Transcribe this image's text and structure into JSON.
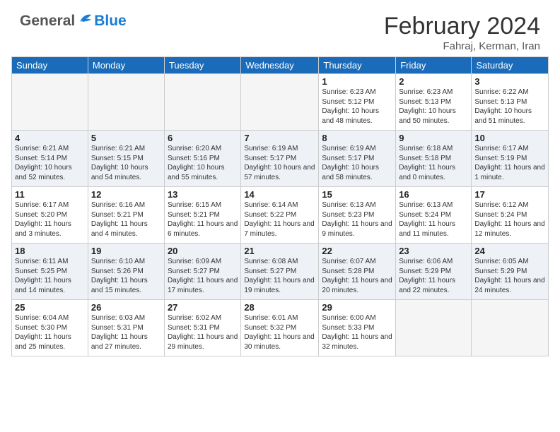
{
  "header": {
    "logo_general": "General",
    "logo_blue": "Blue",
    "month_year": "February 2024",
    "location": "Fahraj, Kerman, Iran"
  },
  "weekdays": [
    "Sunday",
    "Monday",
    "Tuesday",
    "Wednesday",
    "Thursday",
    "Friday",
    "Saturday"
  ],
  "weeks": [
    [
      {
        "day": "",
        "empty": true
      },
      {
        "day": "",
        "empty": true
      },
      {
        "day": "",
        "empty": true
      },
      {
        "day": "",
        "empty": true
      },
      {
        "day": "1",
        "sunrise": "6:23 AM",
        "sunset": "5:12 PM",
        "daylight": "10 hours and 48 minutes."
      },
      {
        "day": "2",
        "sunrise": "6:23 AM",
        "sunset": "5:13 PM",
        "daylight": "10 hours and 50 minutes."
      },
      {
        "day": "3",
        "sunrise": "6:22 AM",
        "sunset": "5:13 PM",
        "daylight": "10 hours and 51 minutes."
      }
    ],
    [
      {
        "day": "4",
        "sunrise": "6:21 AM",
        "sunset": "5:14 PM",
        "daylight": "10 hours and 52 minutes."
      },
      {
        "day": "5",
        "sunrise": "6:21 AM",
        "sunset": "5:15 PM",
        "daylight": "10 hours and 54 minutes."
      },
      {
        "day": "6",
        "sunrise": "6:20 AM",
        "sunset": "5:16 PM",
        "daylight": "10 hours and 55 minutes."
      },
      {
        "day": "7",
        "sunrise": "6:19 AM",
        "sunset": "5:17 PM",
        "daylight": "10 hours and 57 minutes."
      },
      {
        "day": "8",
        "sunrise": "6:19 AM",
        "sunset": "5:17 PM",
        "daylight": "10 hours and 58 minutes."
      },
      {
        "day": "9",
        "sunrise": "6:18 AM",
        "sunset": "5:18 PM",
        "daylight": "11 hours and 0 minutes."
      },
      {
        "day": "10",
        "sunrise": "6:17 AM",
        "sunset": "5:19 PM",
        "daylight": "11 hours and 1 minute."
      }
    ],
    [
      {
        "day": "11",
        "sunrise": "6:17 AM",
        "sunset": "5:20 PM",
        "daylight": "11 hours and 3 minutes."
      },
      {
        "day": "12",
        "sunrise": "6:16 AM",
        "sunset": "5:21 PM",
        "daylight": "11 hours and 4 minutes."
      },
      {
        "day": "13",
        "sunrise": "6:15 AM",
        "sunset": "5:21 PM",
        "daylight": "11 hours and 6 minutes."
      },
      {
        "day": "14",
        "sunrise": "6:14 AM",
        "sunset": "5:22 PM",
        "daylight": "11 hours and 7 minutes."
      },
      {
        "day": "15",
        "sunrise": "6:13 AM",
        "sunset": "5:23 PM",
        "daylight": "11 hours and 9 minutes."
      },
      {
        "day": "16",
        "sunrise": "6:13 AM",
        "sunset": "5:24 PM",
        "daylight": "11 hours and 11 minutes."
      },
      {
        "day": "17",
        "sunrise": "6:12 AM",
        "sunset": "5:24 PM",
        "daylight": "11 hours and 12 minutes."
      }
    ],
    [
      {
        "day": "18",
        "sunrise": "6:11 AM",
        "sunset": "5:25 PM",
        "daylight": "11 hours and 14 minutes."
      },
      {
        "day": "19",
        "sunrise": "6:10 AM",
        "sunset": "5:26 PM",
        "daylight": "11 hours and 15 minutes."
      },
      {
        "day": "20",
        "sunrise": "6:09 AM",
        "sunset": "5:27 PM",
        "daylight": "11 hours and 17 minutes."
      },
      {
        "day": "21",
        "sunrise": "6:08 AM",
        "sunset": "5:27 PM",
        "daylight": "11 hours and 19 minutes."
      },
      {
        "day": "22",
        "sunrise": "6:07 AM",
        "sunset": "5:28 PM",
        "daylight": "11 hours and 20 minutes."
      },
      {
        "day": "23",
        "sunrise": "6:06 AM",
        "sunset": "5:29 PM",
        "daylight": "11 hours and 22 minutes."
      },
      {
        "day": "24",
        "sunrise": "6:05 AM",
        "sunset": "5:29 PM",
        "daylight": "11 hours and 24 minutes."
      }
    ],
    [
      {
        "day": "25",
        "sunrise": "6:04 AM",
        "sunset": "5:30 PM",
        "daylight": "11 hours and 25 minutes."
      },
      {
        "day": "26",
        "sunrise": "6:03 AM",
        "sunset": "5:31 PM",
        "daylight": "11 hours and 27 minutes."
      },
      {
        "day": "27",
        "sunrise": "6:02 AM",
        "sunset": "5:31 PM",
        "daylight": "11 hours and 29 minutes."
      },
      {
        "day": "28",
        "sunrise": "6:01 AM",
        "sunset": "5:32 PM",
        "daylight": "11 hours and 30 minutes."
      },
      {
        "day": "29",
        "sunrise": "6:00 AM",
        "sunset": "5:33 PM",
        "daylight": "11 hours and 32 minutes."
      },
      {
        "day": "",
        "empty": true
      },
      {
        "day": "",
        "empty": true
      }
    ]
  ],
  "labels": {
    "sunrise": "Sunrise: ",
    "sunset": "Sunset: ",
    "daylight": "Daylight: "
  }
}
